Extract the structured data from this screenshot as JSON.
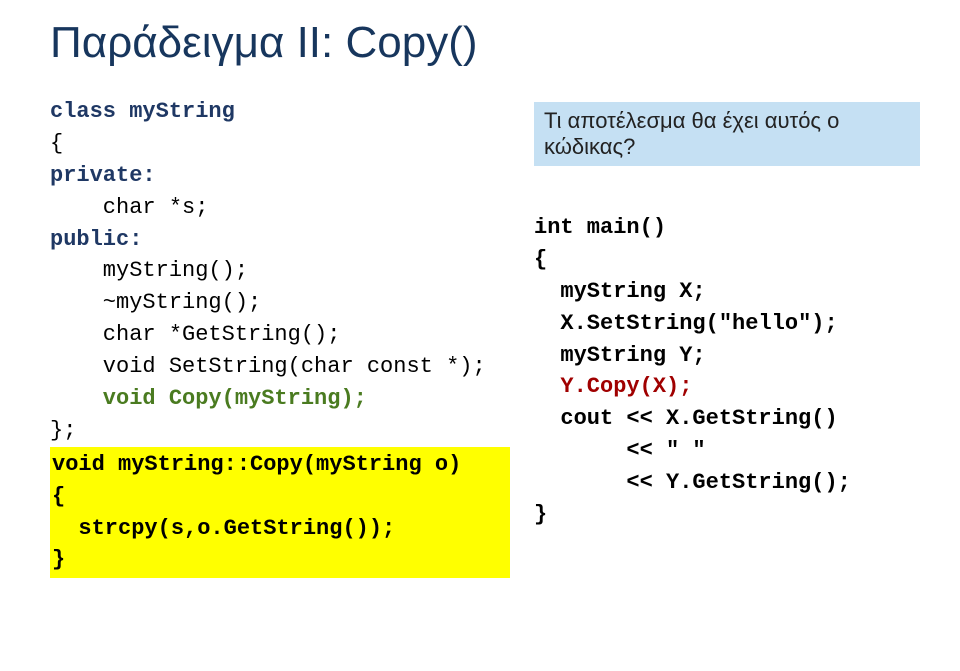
{
  "title": "Παράδειγμα II: Copy()",
  "classHead": "class myString",
  "classOpen": "{",
  "private": "private:",
  "charS": "    char *s;",
  "public": "public:",
  "ctor": "    myString();",
  "dtor": "    ~myString();",
  "getStr": "    char *GetString();",
  "setStr": "    void SetString(char const *);",
  "copyDecl": "    void Copy(myString);",
  "classClose": "};",
  "funcHead": "void myString::Copy(myString o)",
  "funcOpen": "{",
  "funcBody": "  strcpy(s,o.GetString());",
  "funcClose": "}",
  "note": "Τι αποτέλεσμα θα έχει αυτός ο κώδικας?",
  "mainHead": "int main()",
  "mainOpen": "{",
  "mainL1": "  myString X;",
  "mainL2a": "  X.SetString(",
  "mainL2b": "\"",
  "mainL2c": "hello",
  "mainL2d": "\"",
  "mainL2e": ");",
  "mainL3": "  myString Y;",
  "mainL4": "  Y.Copy(X);",
  "mainL5a": "  cout << X.GetString()",
  "mainL5b": "       << ",
  "mainL5c": "\" \"",
  "mainL5d": "       << Y.GetString();",
  "mainClose": "}"
}
